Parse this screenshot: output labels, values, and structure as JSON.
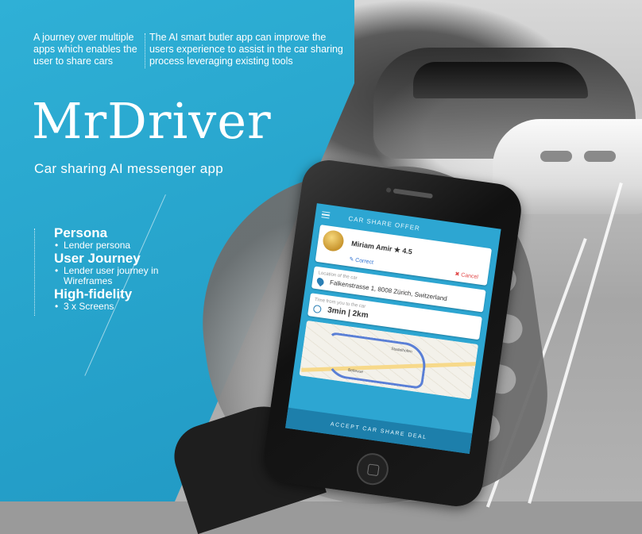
{
  "intro": {
    "left": "A journey over multiple apps which enables the user to share cars",
    "right": "The AI smart butler app can improve the users experience to assist in the car sharing process leveraging existing tools"
  },
  "title": "MrDriver",
  "subtitle": "Car sharing AI messenger app",
  "sections": [
    {
      "title": "Persona",
      "items": [
        "Lender persona"
      ]
    },
    {
      "title": "User Journey",
      "items": [
        "Lender user journey in Wireframes"
      ]
    },
    {
      "title": "High-fidelity",
      "items": [
        "3 x Screens"
      ]
    }
  ],
  "phone": {
    "header": "CAR SHARE OFFER",
    "profile_name": "Miriam Amir ★ 4.5",
    "accept": "✎ Correct",
    "cancel": "✖ Cancel",
    "location_label": "Location of the car",
    "location": "Falkenstrasse 1, 8008 Zürich, Switzerland",
    "time_label": "Time from you to the car",
    "time": "3min | 2km",
    "map_label_1": "Stadelhofen",
    "map_label_2": "Bellevue",
    "cta": "ACCEPT CAR SHARE DEAL"
  },
  "colors": {
    "panel": "#27a4cc",
    "accent": "#1d7fab"
  }
}
